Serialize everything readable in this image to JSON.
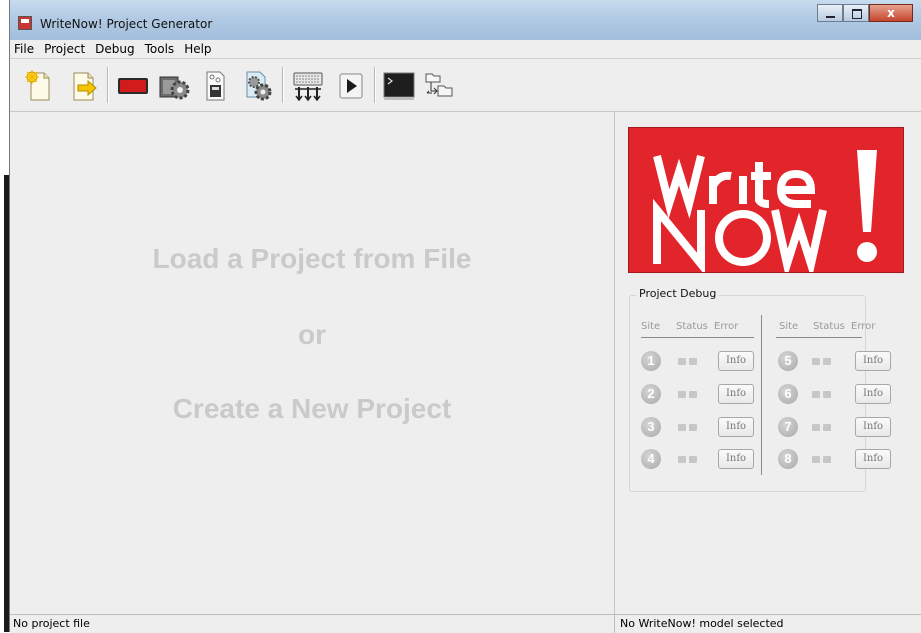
{
  "window": {
    "title": "WriteNow! Project Generator",
    "close_label": "x"
  },
  "menu": [
    "File",
    "Project",
    "Debug",
    "Tools",
    "Help"
  ],
  "toolbar": [
    {
      "icon": "new-project-icon"
    },
    {
      "icon": "open-project-icon"
    },
    {
      "icon": "device-icon"
    },
    {
      "icon": "build-icon"
    },
    {
      "icon": "document-settings-icon"
    },
    {
      "icon": "generate-icon"
    },
    {
      "icon": "keyboard-icon"
    },
    {
      "icon": "play-icon"
    },
    {
      "icon": "terminal-icon"
    },
    {
      "icon": "folder-tree-icon"
    }
  ],
  "main": {
    "line1": "Load a Project from File",
    "line2": "or",
    "line3": "Create a New Project"
  },
  "logo": {
    "brand_color": "#e2242b"
  },
  "debug": {
    "title": "Project Debug",
    "headers": {
      "site": "Site",
      "status": "Status",
      "error": "Error"
    },
    "sites": [
      {
        "n": "1",
        "info": "Info"
      },
      {
        "n": "2",
        "info": "Info"
      },
      {
        "n": "3",
        "info": "Info"
      },
      {
        "n": "4",
        "info": "Info"
      },
      {
        "n": "5",
        "info": "Info"
      },
      {
        "n": "6",
        "info": "Info"
      },
      {
        "n": "7",
        "info": "Info"
      },
      {
        "n": "8",
        "info": "Info"
      }
    ]
  },
  "status": {
    "left": "No project file",
    "right": "No WriteNow! model selected"
  }
}
